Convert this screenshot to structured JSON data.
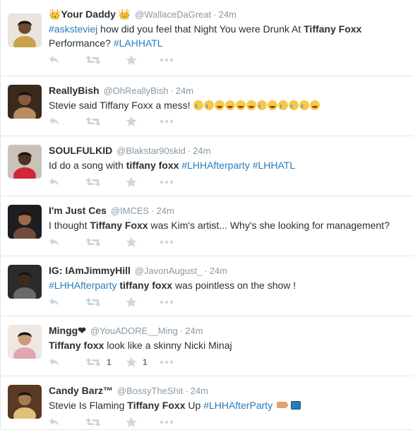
{
  "tweets": [
    {
      "fullname": "👑Your Daddy 👑",
      "username": "@WallaceDaGreat",
      "time": "24m",
      "parts": [
        {
          "t": "hash",
          "v": "#asksteviej"
        },
        {
          "t": "plain",
          "v": " how did you feel that Night You were Drunk At "
        },
        {
          "t": "bold",
          "v": "Tiffany Foxx"
        },
        {
          "t": "plain",
          "v": " Performance? "
        },
        {
          "t": "hash",
          "v": "#LAHHATL"
        }
      ],
      "retweets": "",
      "favorites": ""
    },
    {
      "fullname": "ReallyBish",
      "username": "@OhReallyBish",
      "time": "24m",
      "parts": [
        {
          "t": "plain",
          "v": "Stevie said Tiffany Foxx a mess! "
        }
      ],
      "emojis": [
        "cry",
        "cry",
        "laugh",
        "laugh",
        "laugh",
        "laugh",
        "cry",
        "laugh",
        "cry",
        "cry",
        "cry",
        "laugh"
      ],
      "retweets": "",
      "favorites": ""
    },
    {
      "fullname": "SOULFULKID",
      "username": "@Blakstar90skid",
      "time": "24m",
      "parts": [
        {
          "t": "plain",
          "v": "Id do a song with "
        },
        {
          "t": "bold",
          "v": "tiffany foxx"
        },
        {
          "t": "plain",
          "v": " "
        },
        {
          "t": "hash",
          "v": "#LHHAfterparty"
        },
        {
          "t": "plain",
          "v": " "
        },
        {
          "t": "hash",
          "v": "#LHHATL"
        }
      ],
      "retweets": "",
      "favorites": ""
    },
    {
      "fullname": "I'm Just Ces",
      "username": "@IMCES",
      "time": "24m",
      "parts": [
        {
          "t": "plain",
          "v": "I thought "
        },
        {
          "t": "bold",
          "v": "Tiffany Foxx"
        },
        {
          "t": "plain",
          "v": " was Kim's artist... Why's she looking for management?"
        }
      ],
      "retweets": "",
      "favorites": ""
    },
    {
      "fullname": "IG: IAmJimmyHill",
      "username": "@JavonAugust_",
      "time": "24m",
      "parts": [
        {
          "t": "hash",
          "v": "#LHHAfterparty"
        },
        {
          "t": "plain",
          "v": " "
        },
        {
          "t": "bold",
          "v": "tiffany foxx"
        },
        {
          "t": "plain",
          "v": " was pointless on the show !"
        }
      ],
      "retweets": "",
      "favorites": ""
    },
    {
      "fullname": "Mingg❤",
      "username": "@YouADORE__Ming",
      "time": "24m",
      "parts": [
        {
          "t": "bold",
          "v": "Tiffany foxx"
        },
        {
          "t": "plain",
          "v": " look like a skinny Nicki Minaj"
        }
      ],
      "retweets": "1",
      "favorites": "1"
    },
    {
      "fullname": "Candy Barz™",
      "username": "@BossyTheShit",
      "time": "24m",
      "parts": [
        {
          "t": "plain",
          "v": "Stevie Is Flaming "
        },
        {
          "t": "bold",
          "v": "Tiffany Foxx"
        },
        {
          "t": "plain",
          "v": " Up "
        },
        {
          "t": "hash",
          "v": "#LHHAfterParty"
        }
      ],
      "trailing_icons": [
        "pointing-hand-icon",
        "tv-icon"
      ],
      "retweets": "",
      "favorites": ""
    }
  ],
  "separator": "·",
  "colors": {
    "hashtag": "#2b7bb9",
    "meta": "#8899a6",
    "action_icon": "#ccd6dd",
    "border": "#e1e8ed"
  },
  "icons": {
    "reply": "reply-icon",
    "retweet": "retweet-icon",
    "favorite": "star-icon",
    "more": "more-icon"
  }
}
